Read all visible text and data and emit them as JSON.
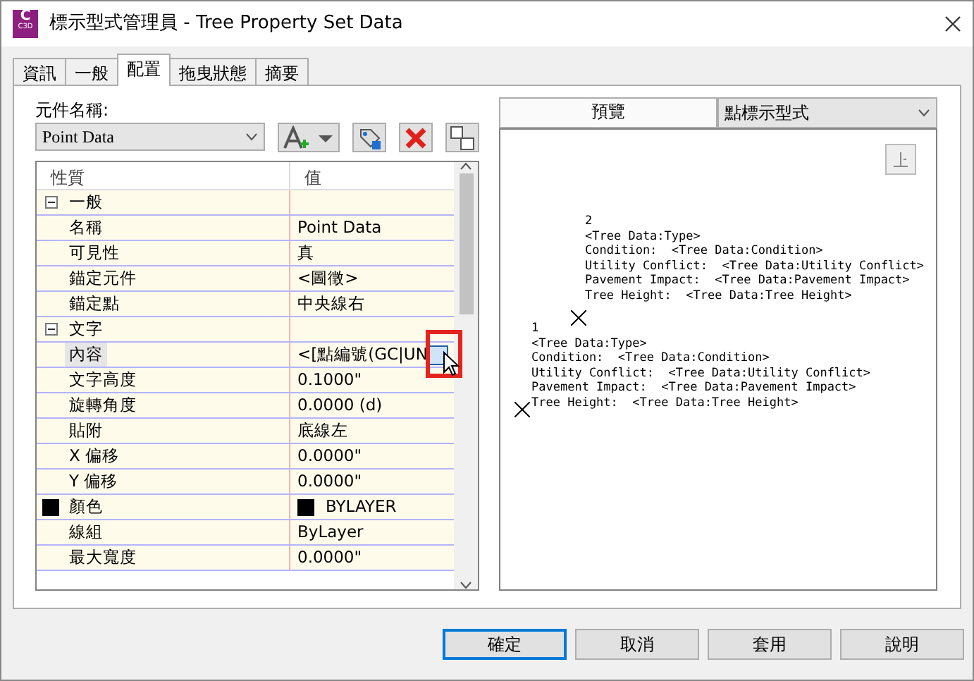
{
  "window": {
    "title": "標示型式管理員 - Tree Property Set Data",
    "logo_letter": "C",
    "logo_caption": "C3D"
  },
  "tabs": [
    {
      "label": "資訊",
      "selected": false
    },
    {
      "label": "一般",
      "selected": false
    },
    {
      "label": "配置",
      "selected": true
    },
    {
      "label": "拖曳狀態",
      "selected": false
    },
    {
      "label": "摘要",
      "selected": false
    }
  ],
  "component": {
    "label": "元件名稱:",
    "value": "Point Data"
  },
  "grid": {
    "columns": [
      "性質",
      "值"
    ],
    "groups": [
      {
        "name": "一般",
        "expanded": true,
        "rows": [
          {
            "property": "名稱",
            "value": "Point Data",
            "selected": false
          },
          {
            "property": "可見性",
            "value": "真",
            "selected": false
          },
          {
            "property": "錨定元件",
            "value": "<圖徵>",
            "selected": false
          },
          {
            "property": "錨定點",
            "value": "中央線右",
            "selected": false
          }
        ]
      },
      {
        "name": "文字",
        "expanded": true,
        "rows": [
          {
            "property": "內容",
            "value": "<[點編號(GC|UN",
            "selected": true,
            "kind": "editor"
          },
          {
            "property": "文字高度",
            "value": "0.1000\"",
            "selected": false
          },
          {
            "property": "旋轉角度",
            "value": "0.0000 (d)",
            "selected": false
          },
          {
            "property": "貼附",
            "value": "底線左",
            "selected": false
          },
          {
            "property": "X 偏移",
            "value": "0.0000\"",
            "selected": false
          },
          {
            "property": "Y 偏移",
            "value": "0.0000\"",
            "selected": false
          },
          {
            "property": "顏色",
            "value": "BYLAYER",
            "selected": false,
            "kind": "swatch",
            "color": "#000000"
          },
          {
            "property": "線組",
            "value": "ByLayer",
            "selected": false
          },
          {
            "property": "最大寬度",
            "value": "0.0000\"",
            "selected": false
          }
        ]
      }
    ]
  },
  "preview": {
    "label": "預覽",
    "style": "點標示型式",
    "labels": [
      {
        "lines": [
          "2",
          "<Tree Data:Type>",
          "Condition:  <Tree Data:Condition>",
          "Utility Conflict:  <Tree Data:Utility Conflict>",
          "Pavement Impact:  <Tree Data:Pavement Impact>",
          "Tree Height:  <Tree Data:Tree Height>"
        ]
      },
      {
        "lines": [
          "1",
          "<Tree Data:Type>",
          "Condition:  <Tree Data:Condition>",
          "Utility Conflict:  <Tree Data:Utility Conflict>",
          "Pavement Impact:  <Tree Data:Pavement Impact>",
          "Tree Height:  <Tree Data:Tree Height>"
        ]
      }
    ]
  },
  "buttons": [
    {
      "label": "確定",
      "default": true
    },
    {
      "label": "取消",
      "default": false
    },
    {
      "label": "套用",
      "default": false
    },
    {
      "label": "說明",
      "default": false
    }
  ]
}
